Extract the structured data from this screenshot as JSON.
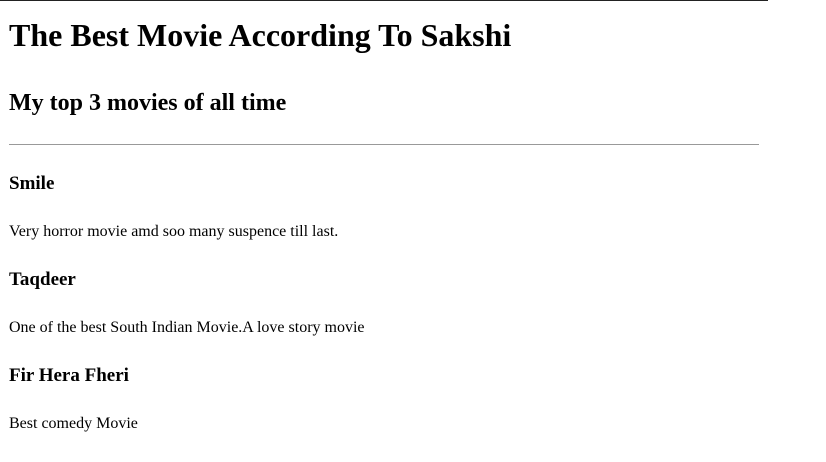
{
  "title": "The Best Movie According To Sakshi",
  "subtitle": "My top 3 movies of all time",
  "movies": [
    {
      "name": "Smile",
      "description": "Very horror movie amd soo many suspence till last."
    },
    {
      "name": "Taqdeer",
      "description": "One of the best South Indian Movie.A love story movie"
    },
    {
      "name": "Fir Hera Fheri",
      "description": "Best comedy Movie"
    }
  ]
}
